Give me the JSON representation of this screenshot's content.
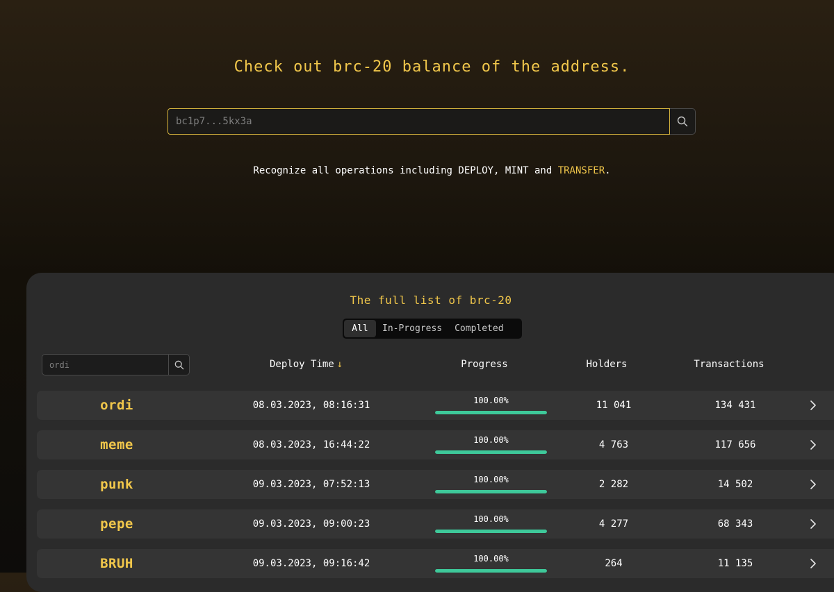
{
  "hero": {
    "title": "Check out brc-20 balance of the address.",
    "search_placeholder": "bc1p7...5kx3a",
    "desc_prefix": "Recognize all operations including DEPLOY, MINT and ",
    "desc_highlight": "TRANSFER",
    "desc_suffix": "."
  },
  "panel": {
    "title": "The full list of brc-20",
    "filters": [
      "All",
      "In-Progress",
      "Completed"
    ],
    "active_filter": "All",
    "search_placeholder": "ordi",
    "columns": {
      "deploy_time": "Deploy Time",
      "progress": "Progress",
      "holders": "Holders",
      "transactions": "Transactions"
    }
  },
  "rows": [
    {
      "tick": "ordi",
      "deploy_time": "08.03.2023, 08:16:31",
      "progress_label": "100.00%",
      "progress": 1.0,
      "holders": "11 041",
      "transactions": "134 431"
    },
    {
      "tick": "meme",
      "deploy_time": "08.03.2023, 16:44:22",
      "progress_label": "100.00%",
      "progress": 1.0,
      "holders": "4 763",
      "transactions": "117 656"
    },
    {
      "tick": "punk",
      "deploy_time": "09.03.2023, 07:52:13",
      "progress_label": "100.00%",
      "progress": 1.0,
      "holders": "2 282",
      "transactions": "14 502"
    },
    {
      "tick": "pepe",
      "deploy_time": "09.03.2023, 09:00:23",
      "progress_label": "100.00%",
      "progress": 1.0,
      "holders": "4 277",
      "transactions": "68 343"
    },
    {
      "tick": "BRUH",
      "deploy_time": "09.03.2023, 09:16:42",
      "progress_label": "100.00%",
      "progress": 1.0,
      "holders": "264",
      "transactions": "11 135"
    }
  ],
  "colors": {
    "accent": "#f1c74b",
    "progress": "#3ec99a",
    "panel": "#2b2b2b",
    "row": "#343434"
  },
  "icons": {
    "search": "search-icon",
    "sort": "arrow-down-icon",
    "row_link": "chevron-right-icon"
  }
}
